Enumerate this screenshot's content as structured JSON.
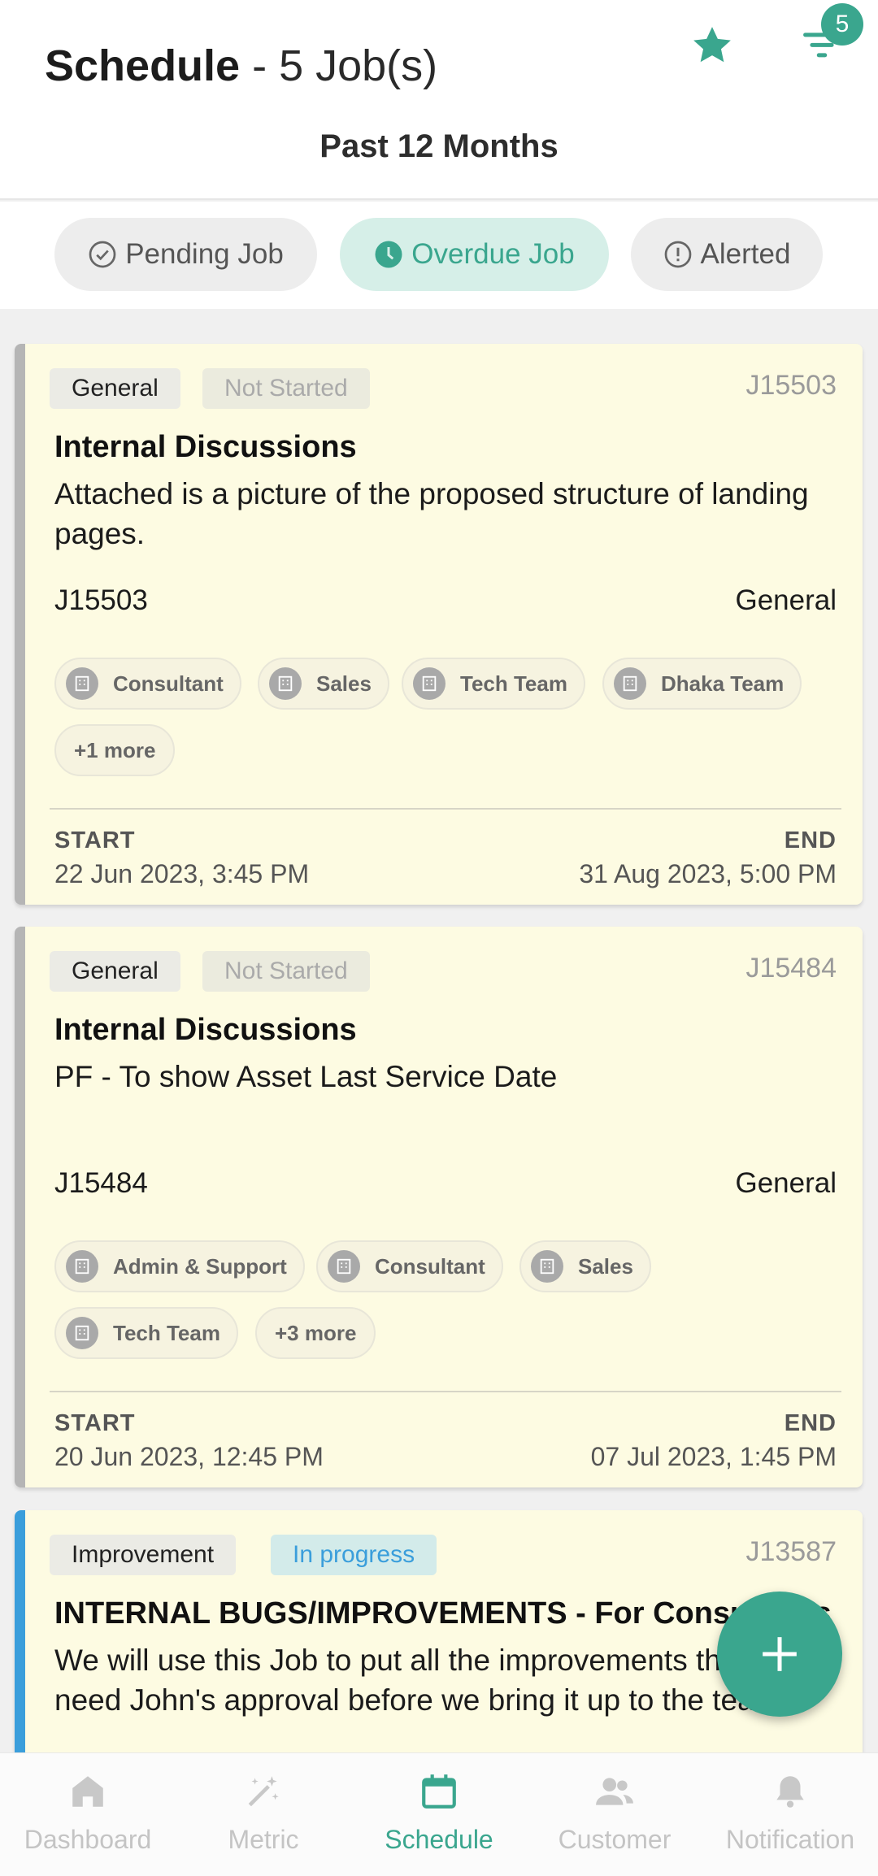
{
  "header": {
    "title": "Schedule",
    "job_count": " - 5 Job(s)",
    "filter_badge": "5",
    "period": "Past 12 Months",
    "accent_color": "#3aa68e"
  },
  "tabs": [
    {
      "label": "Pending Job",
      "icon": "check-circle-icon",
      "active": false
    },
    {
      "label": "Overdue Job",
      "icon": "clock-icon",
      "active": true
    },
    {
      "label": "Alerted",
      "icon": "alert-circle-icon",
      "active": false
    }
  ],
  "jobs": [
    {
      "category": "General",
      "status": "Not Started",
      "id": "J15503",
      "title": "Internal Discussions",
      "description": "Attached is a picture of the proposed structure of landing pages.",
      "ref": "J15503",
      "type": "General",
      "teams": [
        "Consultant",
        "Sales",
        "Tech Team",
        "Dhaka Team"
      ],
      "more": "+1 more",
      "start_label": "START",
      "start": "22 Jun 2023, 3:45 PM",
      "end_label": "END",
      "end": "31 Aug 2023, 5:00 PM"
    },
    {
      "category": "General",
      "status": "Not Started",
      "id": "J15484",
      "title": "Internal Discussions",
      "description": "PF - To show Asset Last Service Date",
      "ref": "J15484",
      "type": "General",
      "teams": [
        "Admin & Support",
        "Consultant",
        "Sales",
        "Tech Team"
      ],
      "more": "+3 more",
      "start_label": "START",
      "start": "20 Jun 2023, 12:45 PM",
      "end_label": "END",
      "end": "07 Jul 2023, 1:45 PM"
    },
    {
      "category": "Improvement",
      "status": "In progress",
      "id": "J13587",
      "title": "INTERNAL BUGS/IMPROVEMENTS - For Consultants",
      "description": "We will use this Job to put all the improvements that will need John's approval before we bring it up to the team."
    }
  ],
  "nav": [
    {
      "label": "Dashboard",
      "icon": "home-icon",
      "active": false
    },
    {
      "label": "Metric",
      "icon": "sparkles-icon",
      "active": false
    },
    {
      "label": "Schedule",
      "icon": "calendar-icon",
      "active": true
    },
    {
      "label": "Customer",
      "icon": "people-icon",
      "active": false
    },
    {
      "label": "Notification",
      "icon": "bell-icon",
      "active": false
    }
  ],
  "fab_icon": "plus-icon"
}
